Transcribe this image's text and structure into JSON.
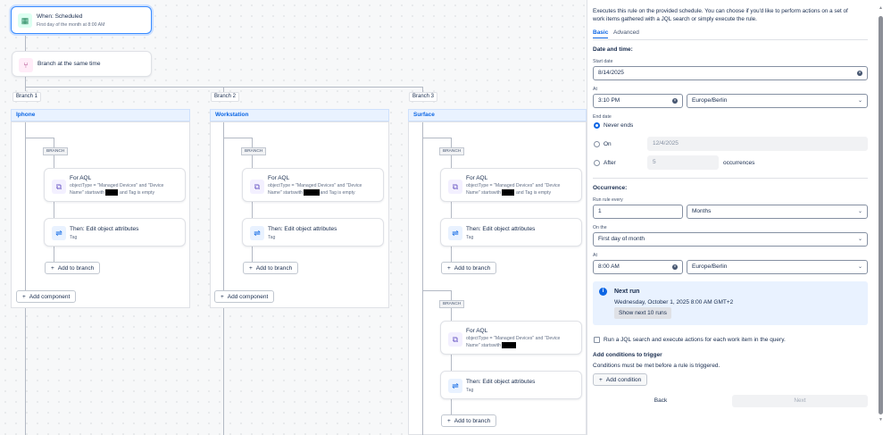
{
  "canvas": {
    "trigger": {
      "title": "When: Scheduled",
      "subtitle": "First day of the month at 8:00 AM"
    },
    "branch_rule": {
      "label": "Branch at the same time"
    },
    "branches": [
      {
        "tag": "Branch 1",
        "header": "Iphone",
        "branch_label": "BRANCH",
        "condition_title": "For AQL",
        "condition_desc_a": "objectType = \"Managed Devices\" and \"Device",
        "condition_desc_b": "Name\" startswith",
        "condition_desc_c": "and Tag is empty",
        "action_title": "Then: Edit object attributes",
        "action_desc": "Tag",
        "add_branch": "Add to branch",
        "add_component": "Add component"
      },
      {
        "tag": "Branch 2",
        "header": "Workstation",
        "branch_label": "BRANCH",
        "condition_title": "For AQL",
        "condition_desc_a": "objectType = \"Managed Devices\" and \"Device",
        "condition_desc_b": "Name\" startswith",
        "condition_desc_c": "and Tag is empty",
        "action_title": "Then: Edit object attributes",
        "action_desc": "Tag",
        "add_branch": "Add to branch",
        "add_component": "Add component"
      },
      {
        "tag": "Branch 3",
        "header": "Surface",
        "branch_label": "BRANCH",
        "condition_title": "For AQL",
        "condition_desc_a": "objectType = \"Managed Devices\" and \"Device",
        "condition_desc_b": "Name\" startswith",
        "condition_desc_c": "and Tag is empty",
        "action_title": "Then: Edit object attributes",
        "action_desc": "Tag",
        "add_branch": "Add to branch"
      }
    ],
    "second_branch": {
      "branch_label": "BRANCH",
      "condition_title": "For AQL",
      "condition_desc_a": "objectType = \"Managed Devices\" and \"Device",
      "condition_desc_b": "Name\" startswith",
      "action_title": "Then: Edit object attributes",
      "action_desc": "Tag",
      "add_branch": "Add to branch"
    }
  },
  "panel": {
    "description": [
      "Executes this rule on the provided schedule. You can choose if you'd like to perform actions on a set of",
      "work items gathered with a JQL search or simply execute the rule."
    ],
    "tabs": [
      "Basic",
      "Advanced"
    ],
    "section_date": "Date and time:",
    "start_label": "Start date",
    "start_value": "8/14/2025",
    "at_label": "At",
    "at_value": "3:10 PM",
    "tz_value": "Europe/Berlin",
    "end_label": "End date",
    "never": "Never ends",
    "on": "On",
    "on_value": "12/4/2025",
    "after": "After",
    "after_value": "5",
    "occurrences": "occurrences",
    "section_occ": "Occurrence:",
    "run_every_label": "Run rule every",
    "run_every_value": "1",
    "unit_value": "Months",
    "on_the_label": "On the",
    "on_the_value": "First day of month",
    "at2_label": "At",
    "at2_value": "8:00 AM",
    "tz2_value": "Europe/Berlin",
    "next_run_title": "Next run",
    "next_run_value": "Wednesday, October 1, 2025 8:00 AM GMT+2",
    "show_next": "Show next 10 runs",
    "jql_check": "Run a JQL search and execute actions for each work item in the query.",
    "add_conditions": "Add conditions to trigger",
    "conditions_desc": "Conditions must be met before a rule is triggered.",
    "add_condition": "Add condition",
    "back": "Back",
    "next": "Next"
  },
  "colors": {
    "accent": "#0c66e4",
    "trigger_border": "#388bff"
  }
}
